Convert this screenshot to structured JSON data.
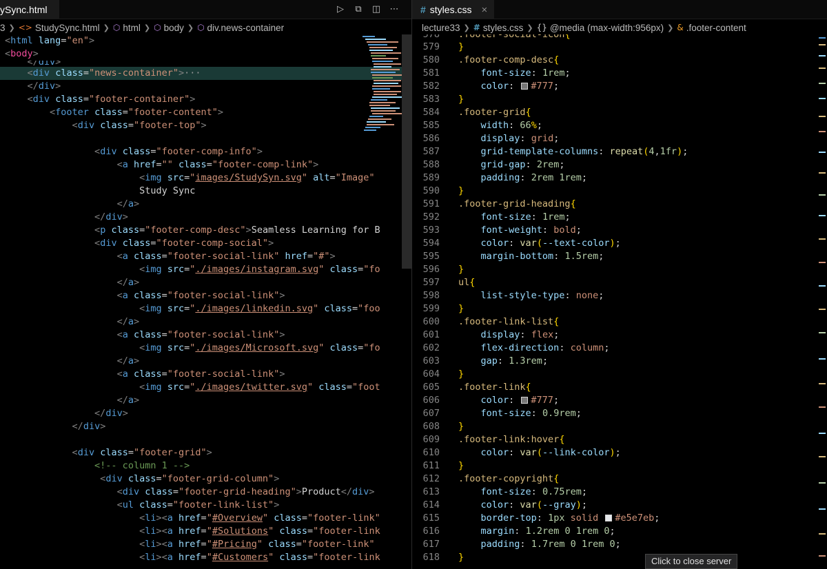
{
  "left_editor": {
    "tab_label": "ySync.html",
    "breadcrumb": [
      "3",
      "StudySync.html",
      "html",
      "body",
      "div.news-container"
    ]
  },
  "right_editor": {
    "tab_label": "styles.css",
    "tab_close": "×",
    "breadcrumb": [
      "lecture33",
      "styles.css",
      "@media (max-width:956px)",
      ".footer-content"
    ]
  },
  "actions": {
    "run_icon": "play-icon",
    "preview_icon": "open-preview-icon",
    "split_icon": "split-editor-icon",
    "more_icon": "more-actions-icon"
  },
  "tooltip": "Click to close server",
  "colors": {
    "background": "#000000",
    "highlight_line": "#1a3a36",
    "tag": "#569cd6",
    "attribute": "#9cdcfe",
    "string": "#ce9178",
    "selector": "#d7ba7d",
    "number": "#b5cea8",
    "swatch_777": "#777777",
    "swatch_e5e7eb": "#e5e7eb"
  }
}
